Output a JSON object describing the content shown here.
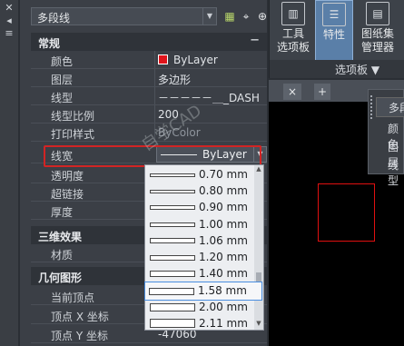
{
  "left_strip": {
    "icons": [
      "close-icon",
      "pin-icon",
      "menu-icon",
      "settings-icon"
    ]
  },
  "properties": {
    "object_type": "多段线",
    "sections": {
      "general": "常规",
      "3d": "三维效果",
      "geometry": "几何图形"
    },
    "collapse_symbol": "−",
    "rows": {
      "color": {
        "label": "颜色",
        "value": "ByLayer"
      },
      "layer": {
        "label": "图层",
        "value": "多边形"
      },
      "linetype": {
        "label": "线型",
        "value": "－－－－－＿_DASH"
      },
      "ltscale": {
        "label": "线型比例",
        "value": "200"
      },
      "plotstyle": {
        "label": "打印样式",
        "value": "ByColor"
      },
      "lineweight": {
        "label": "线宽",
        "value": "ByLayer"
      },
      "transparency": {
        "label": "透明度"
      },
      "hyperlink": {
        "label": "超链接"
      },
      "thickness": {
        "label": "厚度"
      },
      "material": {
        "label": "材质"
      },
      "vertex": {
        "label": "当前顶点"
      },
      "vx": {
        "label": "顶点 X 坐标"
      },
      "vy": {
        "label": "顶点 Y 坐标",
        "value": "-47060"
      }
    }
  },
  "lineweight_options": [
    "0.70 mm",
    "0.80 mm",
    "0.90 mm",
    "1.00 mm",
    "1.06 mm",
    "1.20 mm",
    "1.40 mm",
    "1.58 mm",
    "2.00 mm",
    "2.11 mm"
  ],
  "lineweight_selected": "1.58 mm",
  "ribbon": {
    "buttons": [
      "工具\n选项板",
      "特性",
      "图纸集\n管理器"
    ],
    "group_label": "选项板 ▼"
  },
  "drawing": {
    "tab_close": "×",
    "tab_add": "+"
  },
  "floating_panel": {
    "rows": [
      "多段",
      "颜色",
      "图层",
      "线型"
    ]
  },
  "watermark": "自学CAD",
  "colors": {
    "accent_red": "#d22424",
    "entity_red": "#e01010"
  }
}
